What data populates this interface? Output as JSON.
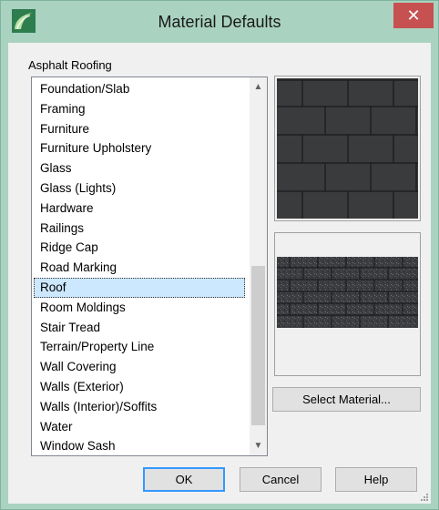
{
  "window": {
    "title": "Material Defaults",
    "close_symbol": "✕"
  },
  "group_label": "Asphalt Roofing",
  "list": {
    "items": [
      "Foundation/Slab",
      "Framing",
      "Furniture",
      "Furniture Upholstery",
      "Glass",
      "Glass (Lights)",
      "Hardware",
      "Railings",
      "Ridge Cap",
      "Road Marking",
      "Roof",
      "Room Moldings",
      "Stair Tread",
      "Terrain/Property Line",
      "Wall Covering",
      "Walls (Exterior)",
      "Walls (Interior)/Soffits",
      "Water",
      "Window Sash"
    ],
    "selected": "Roof",
    "scroll_up": "▲",
    "scroll_down": "▼"
  },
  "buttons": {
    "select_material": "Select Material...",
    "ok": "OK",
    "cancel": "Cancel",
    "help": "Help"
  },
  "colors": {
    "titlebar": "#a9d2c0",
    "close": "#c75050",
    "selection": "#cce8ff",
    "shingle_dark": "#3a3b3d"
  },
  "icons": {
    "app": "chief-architect-app-icon",
    "close": "close-icon",
    "scroll_up": "chevron-up-icon",
    "scroll_down": "chevron-down-icon",
    "grip": "resize-grip-icon"
  }
}
